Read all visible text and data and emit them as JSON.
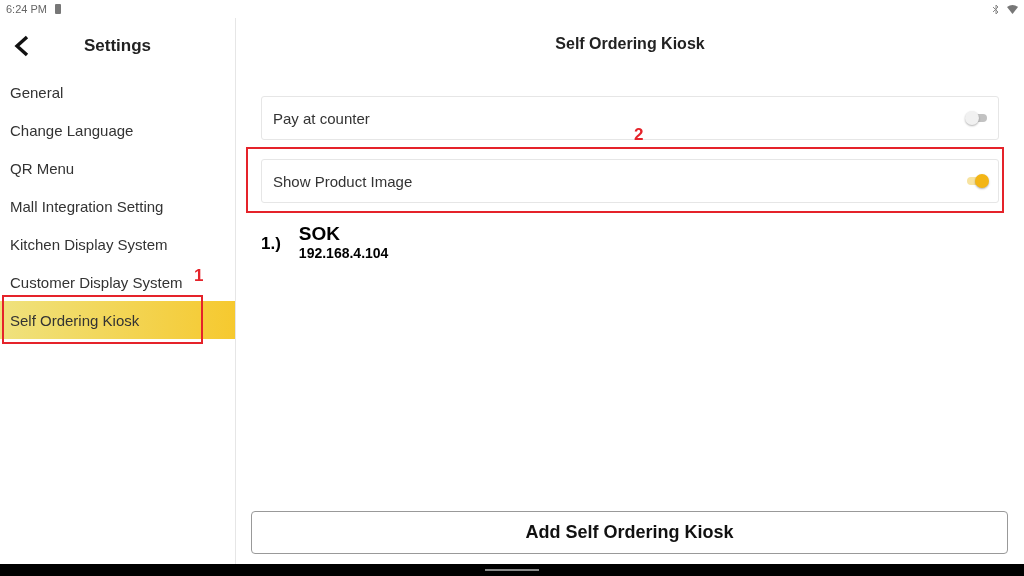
{
  "status_bar": {
    "time": "6:24 PM"
  },
  "sidebar": {
    "title": "Settings",
    "items": [
      {
        "label": "General",
        "selected": false
      },
      {
        "label": "Change Language",
        "selected": false
      },
      {
        "label": "QR Menu",
        "selected": false
      },
      {
        "label": "Mall Integration Setting",
        "selected": false
      },
      {
        "label": "Kitchen Display System",
        "selected": false
      },
      {
        "label": "Customer Display System",
        "selected": false
      },
      {
        "label": "Self Ordering Kiosk",
        "selected": true,
        "callout": "1"
      }
    ]
  },
  "main": {
    "title": "Self Ordering Kiosk",
    "settings": [
      {
        "label": "Pay at counter",
        "on": false
      },
      {
        "label": "Show Product Image",
        "on": true,
        "callout": "2"
      }
    ],
    "kiosks": [
      {
        "number": "1.)",
        "name": "SOK",
        "address": "192.168.4.104"
      }
    ],
    "add_button": "Add Self Ordering Kiosk"
  }
}
